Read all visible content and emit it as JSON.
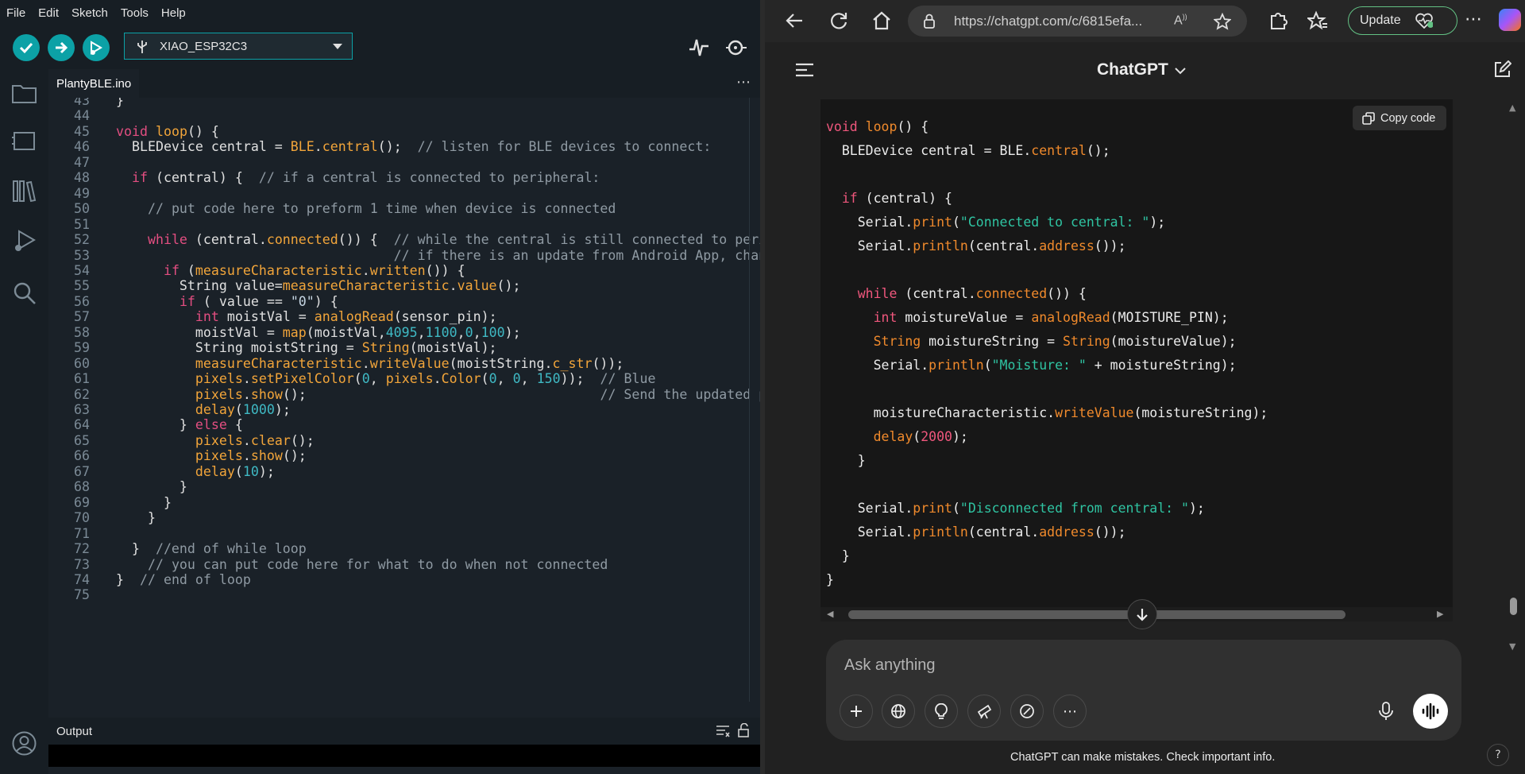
{
  "ide": {
    "menu": [
      "File",
      "Edit",
      "Sketch",
      "Tools",
      "Help"
    ],
    "board": "XIAO_ESP32C3",
    "tab": "PlantyBLE.ino",
    "output_label": "Output",
    "code_lines": [
      {
        "n": "43",
        "text": "}"
      },
      {
        "n": "44",
        "text": ""
      },
      {
        "n": "45",
        "text": "void loop() {"
      },
      {
        "n": "46",
        "text": "  BLEDevice central = BLE.central();  // listen for BLE devices to connect:"
      },
      {
        "n": "47",
        "text": ""
      },
      {
        "n": "48",
        "text": "  if (central) {  // if a central is connected to peripheral:"
      },
      {
        "n": "49",
        "text": ""
      },
      {
        "n": "50",
        "text": "    // put code here to preform 1 time when device is connected"
      },
      {
        "n": "51",
        "text": ""
      },
      {
        "n": "52",
        "text": "    while (central.connected()) {  // while the central is still connected to periphe"
      },
      {
        "n": "53",
        "text": "                                   // if there is an update from Android App, change"
      },
      {
        "n": "54",
        "text": "      if (measureCharacteristic.written()) {"
      },
      {
        "n": "55",
        "text": "        String value=measureCharacteristic.value();"
      },
      {
        "n": "56",
        "text": "        if ( value == \"0\") {"
      },
      {
        "n": "57",
        "text": "          int moistVal = analogRead(sensor_pin);"
      },
      {
        "n": "58",
        "text": "          moistVal = map(moistVal,4095,1100,0,100);"
      },
      {
        "n": "59",
        "text": "          String moistString = String(moistVal);"
      },
      {
        "n": "60",
        "text": "          measureCharacteristic.writeValue(moistString.c_str());"
      },
      {
        "n": "61",
        "text": "          pixels.setPixelColor(0, pixels.Color(0, 0, 150));  // Blue"
      },
      {
        "n": "62",
        "text": "          pixels.show();                                     // Send the updated pixe"
      },
      {
        "n": "63",
        "text": "          delay(1000);"
      },
      {
        "n": "64",
        "text": "        } else {"
      },
      {
        "n": "65",
        "text": "          pixels.clear();"
      },
      {
        "n": "66",
        "text": "          pixels.show();"
      },
      {
        "n": "67",
        "text": "          delay(10);"
      },
      {
        "n": "68",
        "text": "        }"
      },
      {
        "n": "69",
        "text": "      }"
      },
      {
        "n": "70",
        "text": "    }"
      },
      {
        "n": "71",
        "text": ""
      },
      {
        "n": "72",
        "text": "  }  //end of while loop"
      },
      {
        "n": "73",
        "text": "    // you can put code here for what to do when not connected"
      },
      {
        "n": "74",
        "text": "}  // end of loop"
      },
      {
        "n": "75",
        "text": ""
      }
    ]
  },
  "browser": {
    "url": "https://chatgpt.com/c/6815efa...",
    "update_label": "Update",
    "chat_title": "ChatGPT",
    "copy_label": "Copy code",
    "code_lines": [
      "void loop() {",
      "  BLEDevice central = BLE.central();",
      "",
      "  if (central) {",
      "    Serial.print(\"Connected to central: \");",
      "    Serial.println(central.address());",
      "",
      "    while (central.connected()) {",
      "      int moistureValue = analogRead(MOISTURE_PIN);",
      "      String moistureString = String(moistureValue);",
      "      Serial.println(\"Moisture: \" + moistureString);",
      "",
      "      moistureCharacteristic.writeValue(moistureString);",
      "      delay(2000);",
      "    }",
      "",
      "    Serial.print(\"Disconnected from central: \");",
      "    Serial.println(central.address());",
      "  }",
      "}"
    ],
    "composer_placeholder": "Ask anything",
    "disclaimer": "ChatGPT can make mistakes. Check important info.",
    "help": "?"
  },
  "colors": {
    "ide_accent": "#0ca1a6",
    "update_border": "#63c184"
  }
}
